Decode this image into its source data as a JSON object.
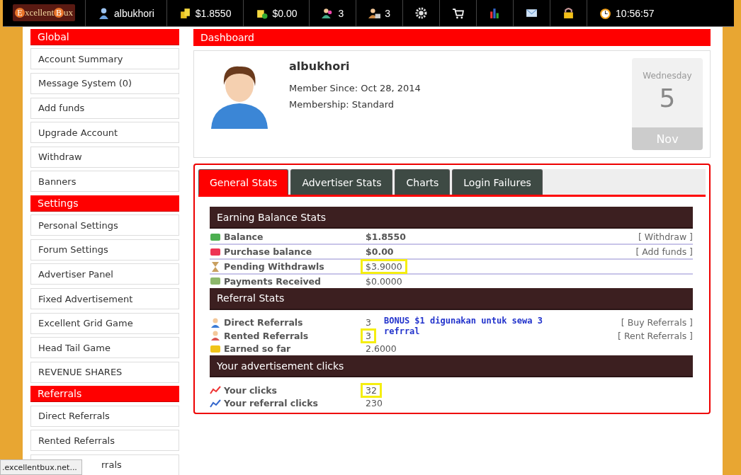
{
  "topbar": {
    "logo": {
      "first": "E",
      "rest": "xcellent",
      "second": "B",
      "tail": "ux"
    },
    "items": [
      {
        "kind": "user",
        "text": "albukhori"
      },
      {
        "kind": "coins",
        "text": "$1.8550"
      },
      {
        "kind": "coins-plus",
        "text": "$0.00"
      },
      {
        "kind": "people",
        "text": "3"
      },
      {
        "kind": "people-rented",
        "text": "3"
      },
      {
        "kind": "gear"
      },
      {
        "kind": "cart"
      },
      {
        "kind": "chart"
      },
      {
        "kind": "mail"
      },
      {
        "kind": "lock"
      },
      {
        "kind": "clock",
        "text": "10:56:57"
      }
    ]
  },
  "sidebar": [
    {
      "kind": "header",
      "label": "Global"
    },
    {
      "kind": "item",
      "label": "Account Summary"
    },
    {
      "kind": "item",
      "label": "Message System (0)"
    },
    {
      "kind": "item",
      "label": "Add funds"
    },
    {
      "kind": "item",
      "label": "Upgrade Account"
    },
    {
      "kind": "item",
      "label": "Withdraw"
    },
    {
      "kind": "item",
      "label": "Banners"
    },
    {
      "kind": "header",
      "label": "Settings"
    },
    {
      "kind": "item",
      "label": "Personal Settings"
    },
    {
      "kind": "item",
      "label": "Forum Settings"
    },
    {
      "kind": "item",
      "label": "Advertiser Panel"
    },
    {
      "kind": "item",
      "label": "Fixed Advertisement"
    },
    {
      "kind": "item",
      "label": "Excellent Grid Game"
    },
    {
      "kind": "item",
      "label": "Head Tail Game"
    },
    {
      "kind": "item",
      "label": "REVENUE SHARES"
    },
    {
      "kind": "header",
      "label": "Referrals"
    },
    {
      "kind": "item",
      "label": "Direct Referrals"
    },
    {
      "kind": "item",
      "label": "Rented Referrals"
    },
    {
      "kind": "covered",
      "label": "rrals"
    }
  ],
  "dashboard": {
    "title": "Dashboard",
    "username": "albukhori",
    "member_since": "Member Since: Oct 28, 2014",
    "membership": "Membership: Standard",
    "calendar": {
      "weekday": "Wednesday",
      "day": "5",
      "month": "Nov"
    }
  },
  "tabs": [
    {
      "label": "General Stats",
      "selected": true
    },
    {
      "label": "Advertiser Stats",
      "selected": false
    },
    {
      "label": "Charts",
      "selected": false
    },
    {
      "label": "Login Failures",
      "selected": false
    }
  ],
  "sections": [
    {
      "title": "Earning Balance Stats",
      "rows": [
        {
          "label": "Balance",
          "value": "$1.8550",
          "bold": true,
          "highlighted": false,
          "action": "[ Withdraw ]"
        },
        {
          "label": "Purchase balance",
          "value": "$0.00",
          "bold": true,
          "highlighted": false,
          "action": "[ Add funds ]"
        },
        {
          "label": "Pending Withdrawls",
          "value": "$3.9000",
          "bold": false,
          "highlighted": true
        },
        {
          "label": "Payments Received",
          "value": "$0.0000",
          "bold": false,
          "highlighted": false
        }
      ]
    },
    {
      "title": "Referral Stats",
      "note": "BONUS $1 digunakan untuk sewa 3 refrral",
      "rows": [
        {
          "label": "Direct Referrals",
          "value": "3",
          "bold": false,
          "highlighted": false,
          "action": "[ Buy Referrals ]"
        },
        {
          "label": "Rented Referrals",
          "value": "3",
          "bold": false,
          "highlighted": true,
          "action": "[ Rent Referrals ]"
        },
        {
          "label": "Earned so far",
          "value": "2.6000",
          "bold": false,
          "highlighted": false
        }
      ]
    },
    {
      "title": "Your advertisement clicks",
      "rows": [
        {
          "label": "Your clicks",
          "value": "32",
          "bold": false,
          "highlighted": true
        },
        {
          "label": "Your referral clicks",
          "value": "230",
          "bold": false,
          "highlighted": false
        }
      ]
    }
  ],
  "status_url": ".excellentbux.net..."
}
